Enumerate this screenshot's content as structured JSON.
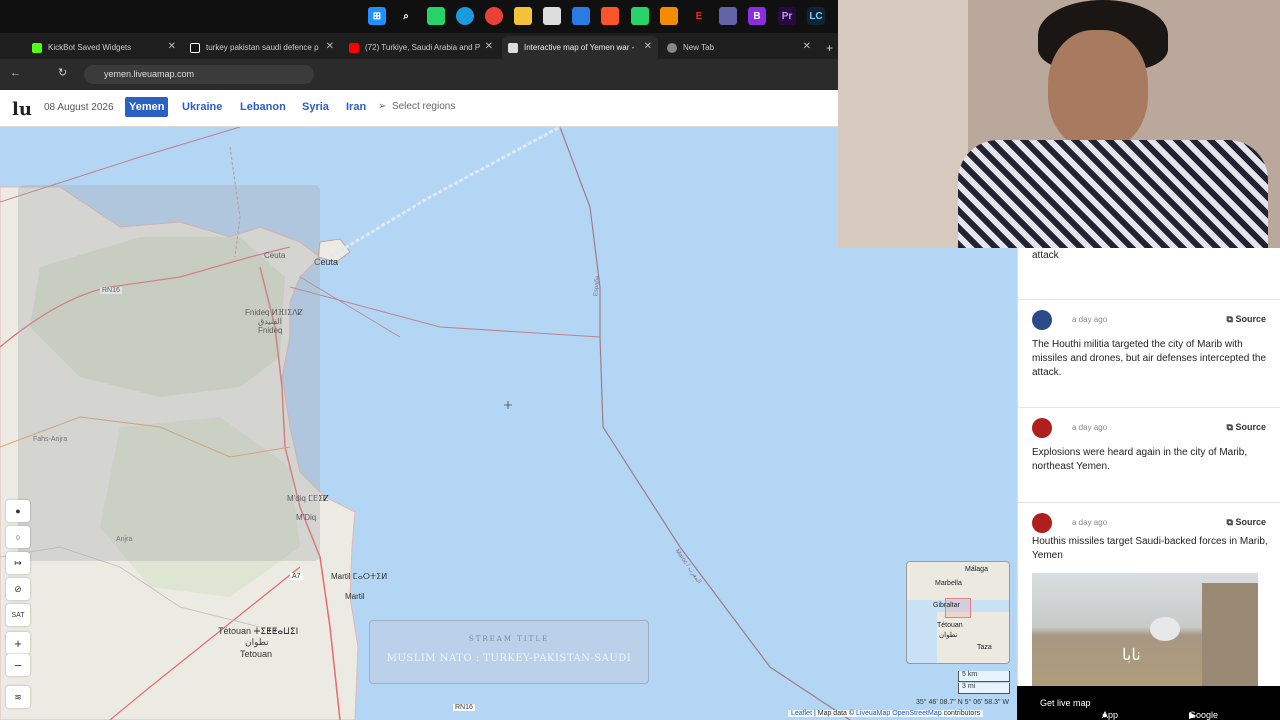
{
  "browser": {
    "tabs": [
      {
        "title": "KickBot Saved Widgets",
        "color": "#53fc18"
      },
      {
        "title": "turkey pakistan saudi defence p",
        "color": "#ffffff"
      },
      {
        "title": "(72) Turkiye, Saudi Arabia and P",
        "color": "#ff0000"
      },
      {
        "title": "Interactive map of Yemen war -",
        "color": "#cccccc"
      },
      {
        "title": "New Tab",
        "color": "#888888"
      }
    ],
    "url": "yemen.liveuamap.com"
  },
  "site": {
    "logo": "lu",
    "date": "08 August 2026",
    "regions": [
      "Yemen",
      "Ukraine",
      "Lebanon",
      "Syria",
      "Iran"
    ],
    "select_regions": "Select regions"
  },
  "map": {
    "labels": {
      "ceuta": "Ceuta",
      "ceuta2": "Ceuta",
      "fnideq": "Fnideq ⵍⴼⵏⵉⴷⵇ",
      "fnideq_ar": "الفنيدق",
      "fnideq2": "Fnideq",
      "mdiq": "M'diq ⵎⴹⵉⵇ",
      "mdiq2": "M'Diq",
      "martil": "Martil ⵎⴰⵔⵜⵉⵍ",
      "martil2": "Martil",
      "tetouan": "Tétouan ⵜⵉⵟⵟⴰⵡⵉⵏ",
      "tetouan_ar": "تطوان",
      "tetouan2": "Tetouan",
      "fahs": "Fahs-Anjra",
      "anjra": "Anjra",
      "rn16": "RN16",
      "rn16b": "RN16",
      "a7": "A7",
      "espana": "España",
      "maroc": "Maroc / المغرب"
    },
    "tools": [
      "●",
      "○",
      "↦",
      "⊘",
      "SAT",
      "+",
      "−",
      "≋"
    ],
    "stream_title": "STREAM TITLE",
    "stream_subtitle": "MUSLIM NATO : TURKEY-PAKISTAN-SAUDI",
    "minimap": {
      "malaga": "Málaga",
      "marbella": "Marbella",
      "gibraltar": "Gibraltar",
      "tetouan": "Tétouan",
      "tetouan_ar": "تطوان",
      "taza": "Taza"
    },
    "scale": [
      "5 km",
      "3 mi"
    ],
    "coords": "35° 46' 08.7\" N 5° 06' 58.3\" W",
    "attribution": {
      "leaflet": "Leaflet",
      "mapdata": "Map data ©",
      "live": "LiveuaMap",
      "osm": "OpenStreetMap",
      "contrib": "contributors"
    }
  },
  "feed": {
    "top_text": "attack",
    "items": [
      {
        "time": "a day ago",
        "source": "Source",
        "text": "The Houthi militia targeted the city of Marib with missiles and drones, but air defenses intercepted the attack."
      },
      {
        "time": "a day ago",
        "source": "Source",
        "text": "Explosions were heard again in the city of Marib, northeast Yemen."
      },
      {
        "time": "a day ago",
        "source": "Source",
        "text": "Houthis missiles target Saudi-backed forces in Marib, Yemen"
      }
    ],
    "photo_watermark": "نابا"
  },
  "footer": {
    "live": "Get live map",
    "appstore": "App Store",
    "gplay": "Google Play"
  }
}
